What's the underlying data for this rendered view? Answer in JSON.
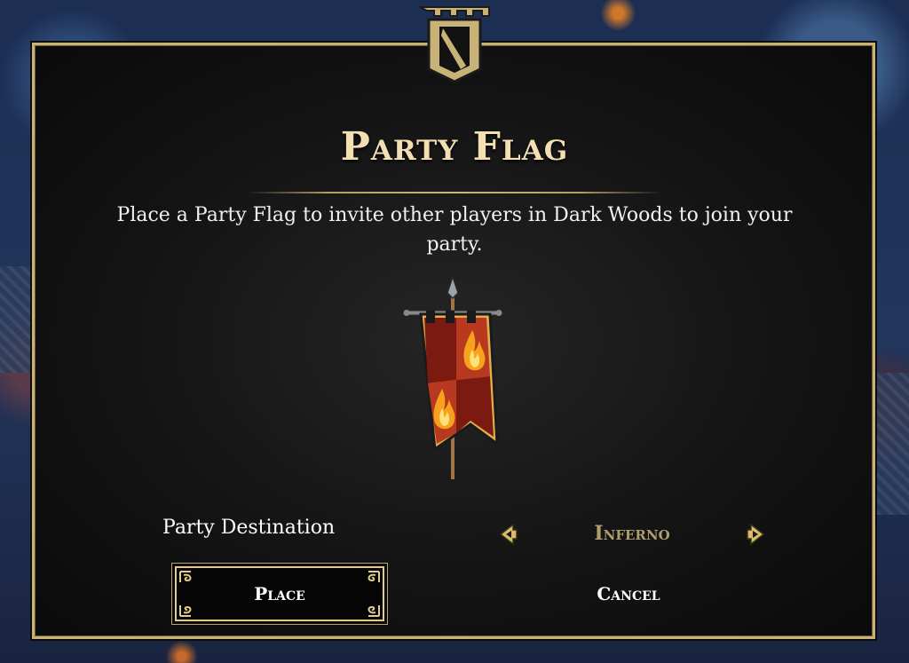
{
  "dialog": {
    "title": "Party Flag",
    "description": "Place a Party Flag to invite other players in Dark Woods to join your party.",
    "destination": {
      "label": "Party Destination",
      "value": "Inferno"
    },
    "buttons": {
      "place_label": "Place",
      "cancel_label": "Cancel"
    }
  },
  "icons": {
    "crest": "tower-banner-icon",
    "flag": "party-flag-icon",
    "prev": "arrow-left-icon",
    "next": "arrow-right-icon"
  },
  "colors": {
    "frame_gold": "#c9b278",
    "title_text": "#f3dfb2",
    "destination_text": "#b29d6c",
    "flag_red": "#b8391f",
    "flag_dark": "#7a1a10",
    "flame": "#f7a21c"
  }
}
